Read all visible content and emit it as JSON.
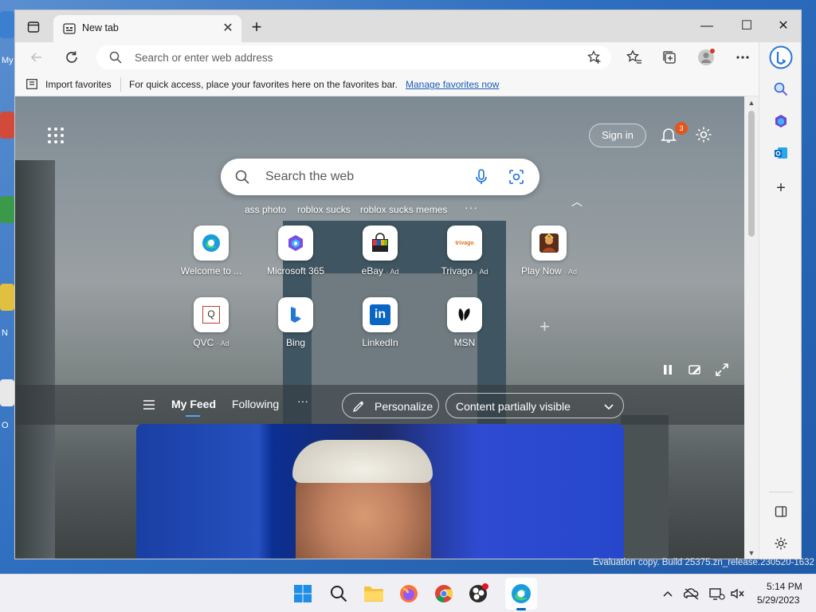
{
  "browser": {
    "tab": {
      "title": "New tab"
    },
    "address": {
      "placeholder": "Search or enter web address"
    },
    "favorites_bar": {
      "import_label": "Import favorites",
      "message": "For quick access, place your favorites here on the favorites bar.",
      "manage_link": "Manage favorites now"
    }
  },
  "newtab": {
    "signin_label": "Sign in",
    "notification_count": "3",
    "search": {
      "placeholder": "Search the web"
    },
    "trending": [
      "ass photo",
      "roblox sucks",
      "roblox sucks memes"
    ],
    "trending_more": "···",
    "tiles": [
      {
        "label": "Welcome to ...",
        "ad": "",
        "icon": "edge-icon"
      },
      {
        "label": "Microsoft 365",
        "ad": "",
        "icon": "microsoft365-icon"
      },
      {
        "label": "eBay",
        "ad": "· Ad",
        "icon": "ebay-icon"
      },
      {
        "label": "Trivago",
        "ad": "· Ad",
        "icon": "trivago-icon"
      },
      {
        "label": "Play Now",
        "ad": "· Ad",
        "icon": "game-icon"
      },
      {
        "label": "QVC",
        "ad": "· Ad",
        "icon": "qvc-icon"
      },
      {
        "label": "Bing",
        "ad": "",
        "icon": "bing-icon"
      },
      {
        "label": "LinkedIn",
        "ad": "",
        "icon": "linkedin-icon"
      },
      {
        "label": "MSN",
        "ad": "",
        "icon": "msn-icon"
      }
    ],
    "trivago_tile_text": "trivago",
    "qvc_tile_text": "Q",
    "linkedin_tile_text": "in",
    "feed": {
      "tabs": [
        "My Feed",
        "Following"
      ],
      "more": "···",
      "personalize_label": "Personalize",
      "content_visibility": "Content partially visible"
    }
  },
  "desktop": {
    "labels": [
      "My",
      "N",
      "O"
    ]
  },
  "watermark": "Evaluation copy. Build 25375.zn_release.230520-1632",
  "taskbar": {
    "time": "5:14 PM",
    "date": "5/29/2023"
  },
  "colors": {
    "accent": "#0067c0",
    "link": "#1a5cb8",
    "badge": "#e0561b"
  }
}
